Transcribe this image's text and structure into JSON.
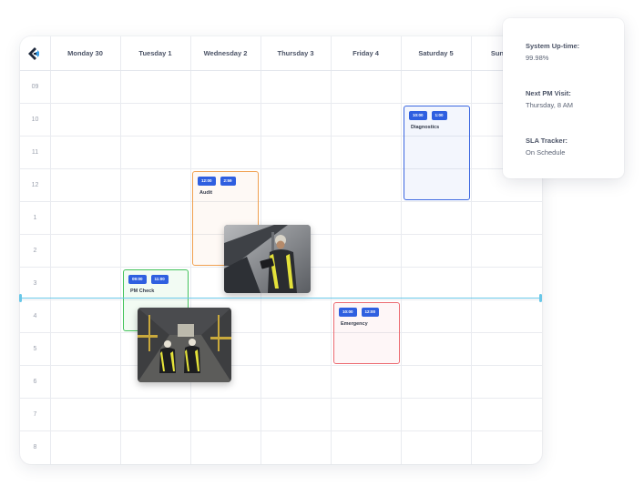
{
  "calendar": {
    "days": [
      "Monday 30",
      "Tuesday 1",
      "Wednesday 2",
      "Thursday 3",
      "Friday 4",
      "Saturday 5",
      "Sunday 6"
    ],
    "hours": [
      "09",
      "10",
      "11",
      "12",
      "1",
      "2",
      "3",
      "4",
      "5",
      "6",
      "7",
      "8"
    ]
  },
  "events": {
    "pm_check": {
      "start": "09:00",
      "end": "11:00",
      "title": "PM Check",
      "color": "#42c25a"
    },
    "audit": {
      "start": "12:00",
      "end": "2:59",
      "title": "Audit",
      "color": "#f0a050"
    },
    "diagnostics": {
      "start": "10:00",
      "end": "1:00",
      "title": "Diagnostics",
      "color": "#3a66e0"
    },
    "emergency": {
      "start": "10:00",
      "end": "12:00",
      "title": "Emergency",
      "color": "#ec6b72"
    }
  },
  "stats": {
    "uptime": {
      "label": "System Up-time:",
      "value": "99.98%"
    },
    "next_pm": {
      "label": "Next PM Visit:",
      "value": "Thursday, 8 AM"
    },
    "sla": {
      "label": "SLA Tracker:",
      "value": "On Schedule"
    }
  },
  "colors": {
    "accent": "#2f5fe0",
    "current_time_line": "#69c7e8"
  },
  "icons": {
    "logo": "brand-logo-icon"
  }
}
